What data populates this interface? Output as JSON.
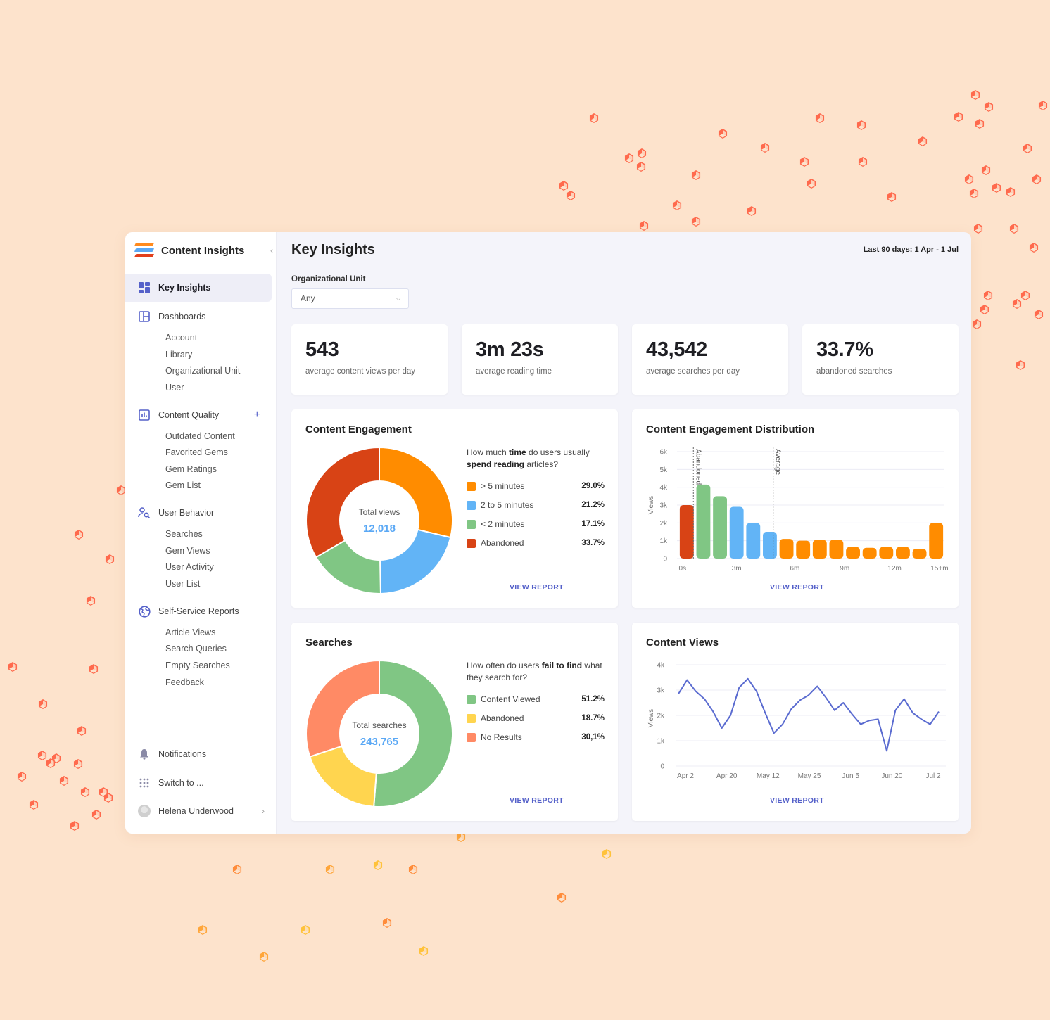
{
  "app": {
    "brand_title": "Content Insights",
    "collapse_icon": "chevron-left-icon"
  },
  "sidebar": {
    "active": {
      "label": "Key Insights",
      "icon": "grid-icon"
    },
    "sections": [
      {
        "label": "Dashboards",
        "icon": "layout-icon",
        "items": [
          "Account",
          "Library",
          "Organizational Unit",
          "User"
        ]
      },
      {
        "label": "Content Quality",
        "icon": "bar-chart-icon",
        "action": "+",
        "items": [
          "Outdated Content",
          "Favorited Gems",
          "Gem Ratings",
          "Gem List"
        ]
      },
      {
        "label": "User Behavior",
        "icon": "user-search-icon",
        "items": [
          "Searches",
          "Gem Views",
          "User Activity",
          "User List"
        ]
      },
      {
        "label": "Self-Service Reports",
        "icon": "globe-icon",
        "items": [
          "Article Views",
          "Search Queries",
          "Empty Searches",
          "Feedback"
        ]
      }
    ],
    "bottom": {
      "notifications": "Notifications",
      "switch_to": "Switch to ...",
      "user_name": "Helena Underwood"
    }
  },
  "header": {
    "title": "Key Insights",
    "date_range": "Last 90 days: 1 Apr  - 1 Jul"
  },
  "filter": {
    "label": "Organizational Unit",
    "selected": "Any"
  },
  "kpis": [
    {
      "value": "543",
      "label": "average content views per day"
    },
    {
      "value": "3m 23s",
      "label": "average reading time"
    },
    {
      "value": "43,542",
      "label": "average searches per day"
    },
    {
      "value": "33.7%",
      "label": "abandoned searches"
    }
  ],
  "view_report_label": "VIEW REPORT",
  "colors": {
    "orange": "#ff8c00",
    "blue": "#62b4f6",
    "green": "#80c684",
    "red": "#d84315",
    "yellow": "#ffd54f",
    "salmon": "#ff8a65",
    "accent": "#5561c9",
    "line": "#5a6bd0",
    "background": "#fde3cc",
    "decor_cube": "#ff6a4d"
  },
  "chart_data": [
    {
      "id": "content_engagement",
      "type": "pie",
      "title": "Content Engagement",
      "center_label": "Total views",
      "center_value": "12,018",
      "question_parts": [
        {
          "text": "How much ",
          "bold": false
        },
        {
          "text": "time",
          "bold": true
        },
        {
          "text": " do users usually ",
          "bold": false
        },
        {
          "text": "spend reading",
          "bold": true
        },
        {
          "text": " articles?",
          "bold": false
        }
      ],
      "slices": [
        {
          "label": "> 5 minutes",
          "value": 29.0,
          "display": "29.0%",
          "color": "#ff8c00"
        },
        {
          "label": "2 to 5 minutes",
          "value": 21.2,
          "display": "21.2%",
          "color": "#62b4f6"
        },
        {
          "label": "< 2 minutes",
          "value": 17.1,
          "display": "17.1%",
          "color": "#80c684"
        },
        {
          "label": "Abandoned",
          "value": 33.7,
          "display": "33.7%",
          "color": "#d84315"
        }
      ]
    },
    {
      "id": "engagement_distribution",
      "type": "bar",
      "title": "Content Engagement Distribution",
      "ylabel": "Views",
      "ylim": [
        0,
        6000
      ],
      "yticks": [
        0,
        1000,
        2000,
        3000,
        4000,
        5000,
        6000
      ],
      "ytick_labels": [
        "0",
        "1k",
        "2k",
        "3k",
        "4k",
        "5k",
        "6k"
      ],
      "xtick_labels": [
        {
          "label": "0s",
          "index": 0
        },
        {
          "label": "3m",
          "index": 3
        },
        {
          "label": "6m",
          "index": 6.5
        },
        {
          "label": "9m",
          "index": 9.5
        },
        {
          "label": "12m",
          "index": 12.5
        },
        {
          "label": "15+m",
          "index": 15.2
        }
      ],
      "values": [
        3000,
        4150,
        3500,
        2900,
        2000,
        1500,
        1100,
        1000,
        1050,
        1050,
        650,
        600,
        650,
        650,
        550,
        2000
      ],
      "colors": [
        "#d84315",
        "#80c684",
        "#80c684",
        "#62b4f6",
        "#62b4f6",
        "#62b4f6",
        "#ff8c00",
        "#ff8c00",
        "#ff8c00",
        "#ff8c00",
        "#ff8c00",
        "#ff8c00",
        "#ff8c00",
        "#ff8c00",
        "#ff8c00",
        "#ff8c00"
      ],
      "reference_lines": [
        {
          "label": "Abandoned",
          "index": 0.4
        },
        {
          "label": "Average",
          "index": 5.2
        }
      ]
    },
    {
      "id": "searches",
      "type": "pie",
      "title": "Searches",
      "center_label": "Total searches",
      "center_value": "243,765",
      "question_parts": [
        {
          "text": "How often do users ",
          "bold": false
        },
        {
          "text": "fail to find",
          "bold": true
        },
        {
          "text": " what they search for?",
          "bold": false
        }
      ],
      "slices": [
        {
          "label": "Content Viewed",
          "value": 51.2,
          "display": "51.2%",
          "color": "#80c684"
        },
        {
          "label": "Abandoned",
          "value": 18.7,
          "display": "18.7%",
          "color": "#ffd54f"
        },
        {
          "label": "No Results",
          "value": 30.1,
          "display": "30,1%",
          "color": "#ff8a65"
        }
      ]
    },
    {
      "id": "content_views",
      "type": "line",
      "title": "Content Views",
      "ylabel": "Views",
      "ylim": [
        0,
        4000
      ],
      "yticks": [
        0,
        1000,
        2000,
        3000,
        4000
      ],
      "ytick_labels": [
        "0",
        "1k",
        "2k",
        "3k",
        "4k"
      ],
      "xtick_labels": [
        "Apr 2",
        "Apr 20",
        "May 12",
        "May 25",
        "Jun 5",
        "Jun 20",
        "Jul 2"
      ],
      "values": [
        2850,
        3400,
        2950,
        2650,
        2150,
        1500,
        2000,
        3100,
        3450,
        2950,
        2100,
        1300,
        1650,
        2250,
        2600,
        2800,
        3150,
        2700,
        2200,
        2500,
        2050,
        1650,
        1800,
        1850,
        600,
        2200,
        2650,
        2100,
        1850,
        1650,
        2150
      ],
      "color": "#5a6bd0"
    }
  ]
}
